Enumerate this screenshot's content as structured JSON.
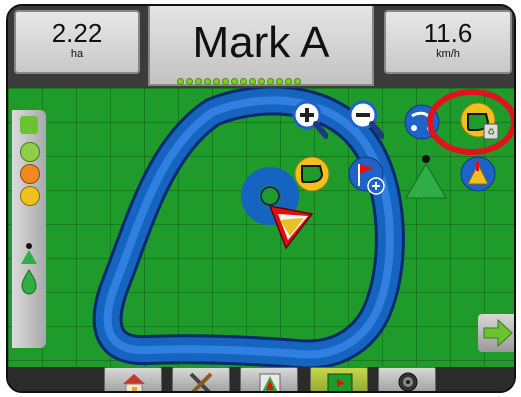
{
  "header": {
    "area_value": "2.22",
    "area_unit": "ha",
    "title": "Mark A",
    "speed_value": "11.6",
    "speed_unit": "km/h"
  },
  "gps_leds": 14,
  "map_buttons": [
    "zoom-in",
    "zoom-out",
    "view-mode",
    "boundary-clear",
    "boundary",
    "add-marker",
    "mark-a",
    "mark-b"
  ],
  "bottom_tabs": [
    "home",
    "tools",
    "guidance",
    "field-map",
    "camera"
  ],
  "colors": {
    "field": "#1f9b2c",
    "swath": "#1565c0",
    "swath_light": "#3d8fe8",
    "highlight_circle": "#e0121e",
    "button_blue": "#1e63c8",
    "button_yellow": "#f0c020"
  }
}
